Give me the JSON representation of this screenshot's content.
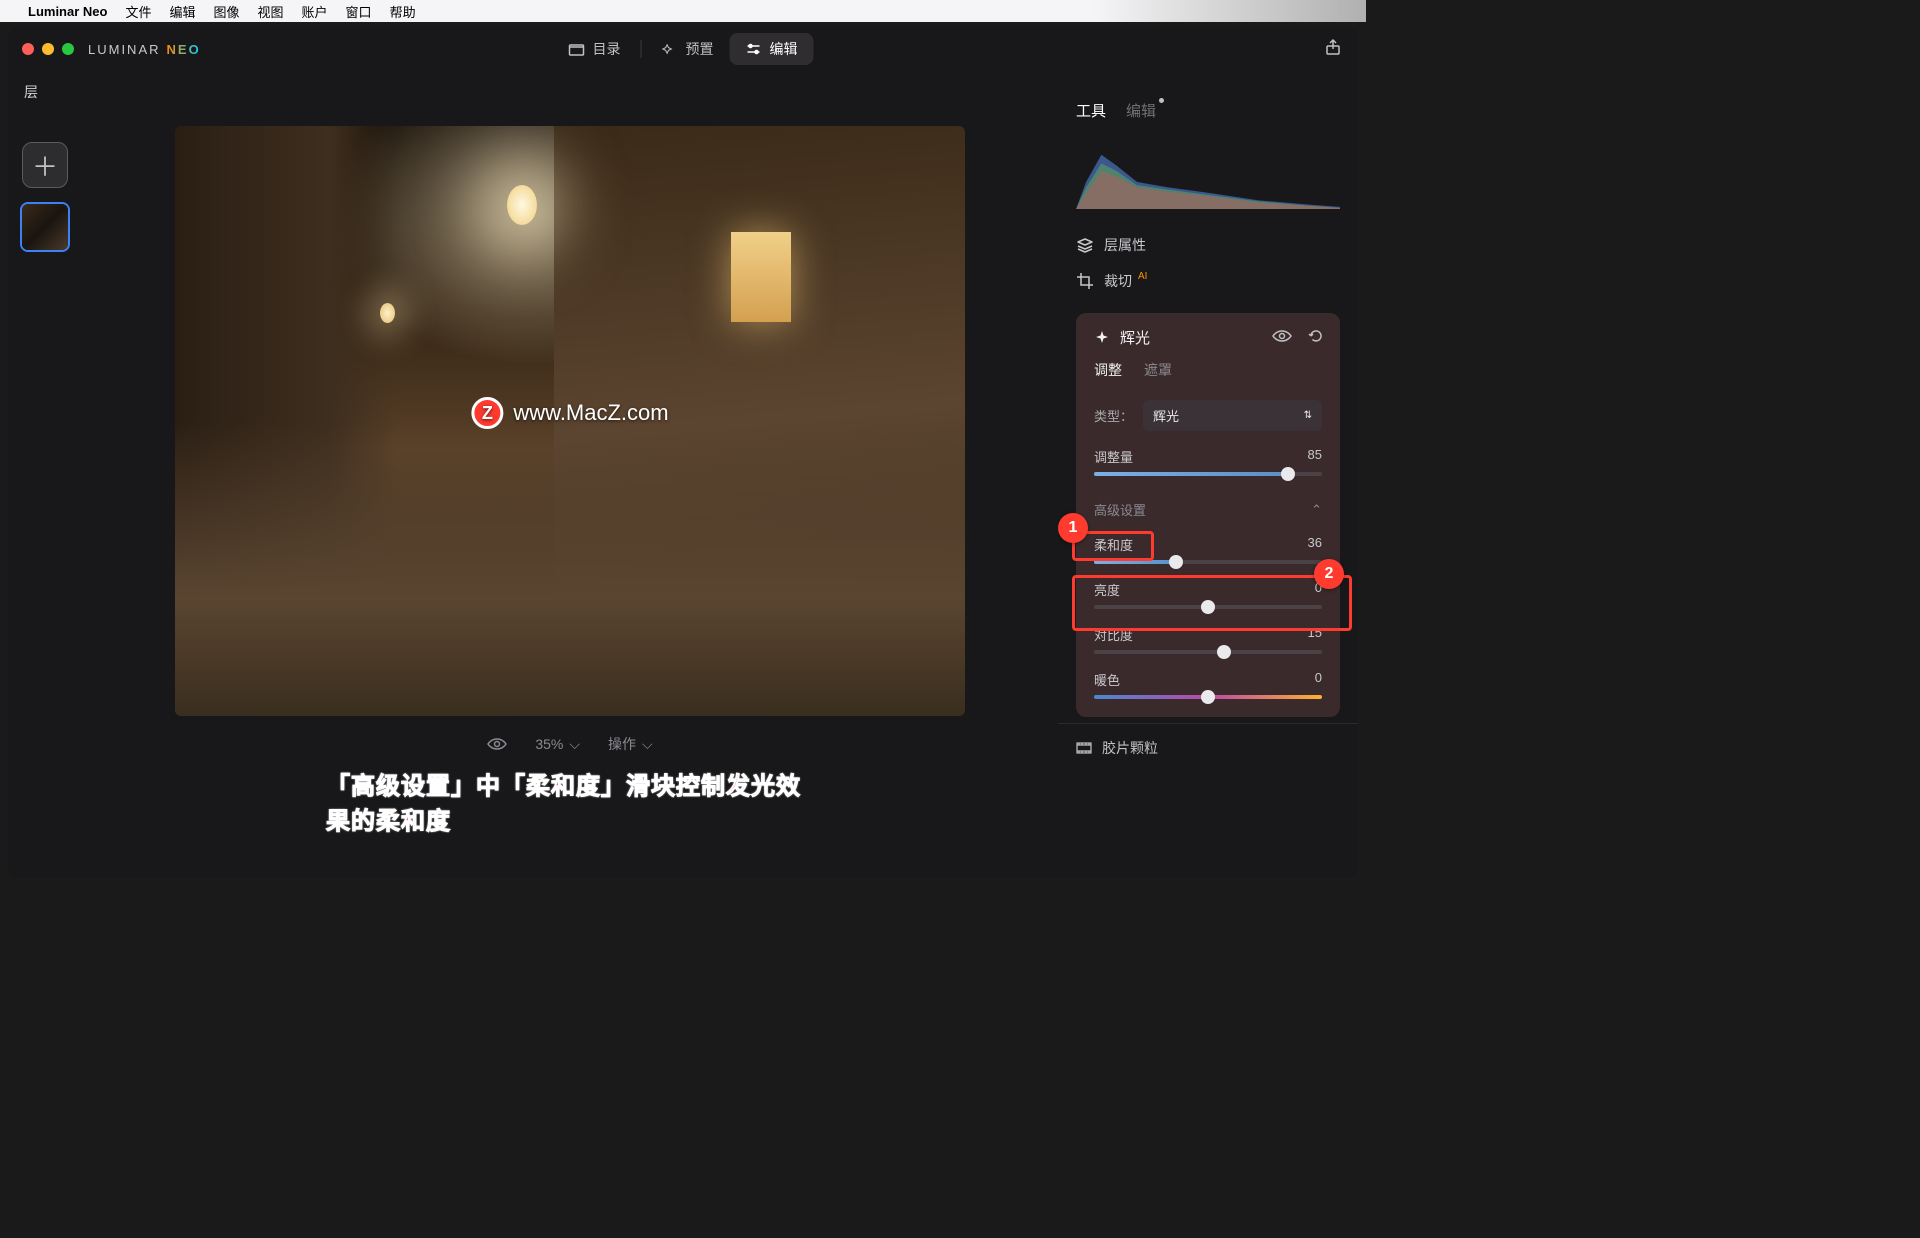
{
  "menubar": {
    "app_name": "Luminar Neo",
    "items": [
      "文件",
      "编辑",
      "图像",
      "视图",
      "账户",
      "窗口",
      "帮助"
    ]
  },
  "brand": {
    "luminar": "LUMINAR",
    "neo": "NEO"
  },
  "top_tabs": {
    "catalog": "目录",
    "presets": "预置",
    "edit": "编辑"
  },
  "layers": {
    "title": "层"
  },
  "watermark": {
    "badge_letter": "Z",
    "text": "www.MacZ.com"
  },
  "canvas_footer": {
    "zoom": "35%",
    "actions": "操作"
  },
  "caption": "「高级设置」中「柔和度」滑块控制发光效果的柔和度",
  "right": {
    "tabs": {
      "tools": "工具",
      "edit": "编辑"
    },
    "layer_props": "层属性",
    "crop": "裁切",
    "glow_card": {
      "title": "辉光",
      "subtab_adjust": "调整",
      "subtab_mask": "遮罩",
      "type_label": "类型：",
      "type_value": "辉光",
      "amount_label": "调整量",
      "amount_value": "85",
      "advanced_label": "高级设置",
      "softness_label": "柔和度",
      "softness_value": "36",
      "brightness_label": "亮度",
      "brightness_value": "0",
      "contrast_label": "对比度",
      "contrast_value": "15",
      "warmth_label": "暖色",
      "warmth_value": "0"
    },
    "film_grain": "胶片颗粒"
  },
  "anno": {
    "badge1": "1",
    "badge2": "2"
  },
  "sliders": {
    "amount_pct": 85,
    "softness_pct": 36,
    "brightness_pct": 50,
    "contrast_pct": 57,
    "warmth_pct": 50
  }
}
